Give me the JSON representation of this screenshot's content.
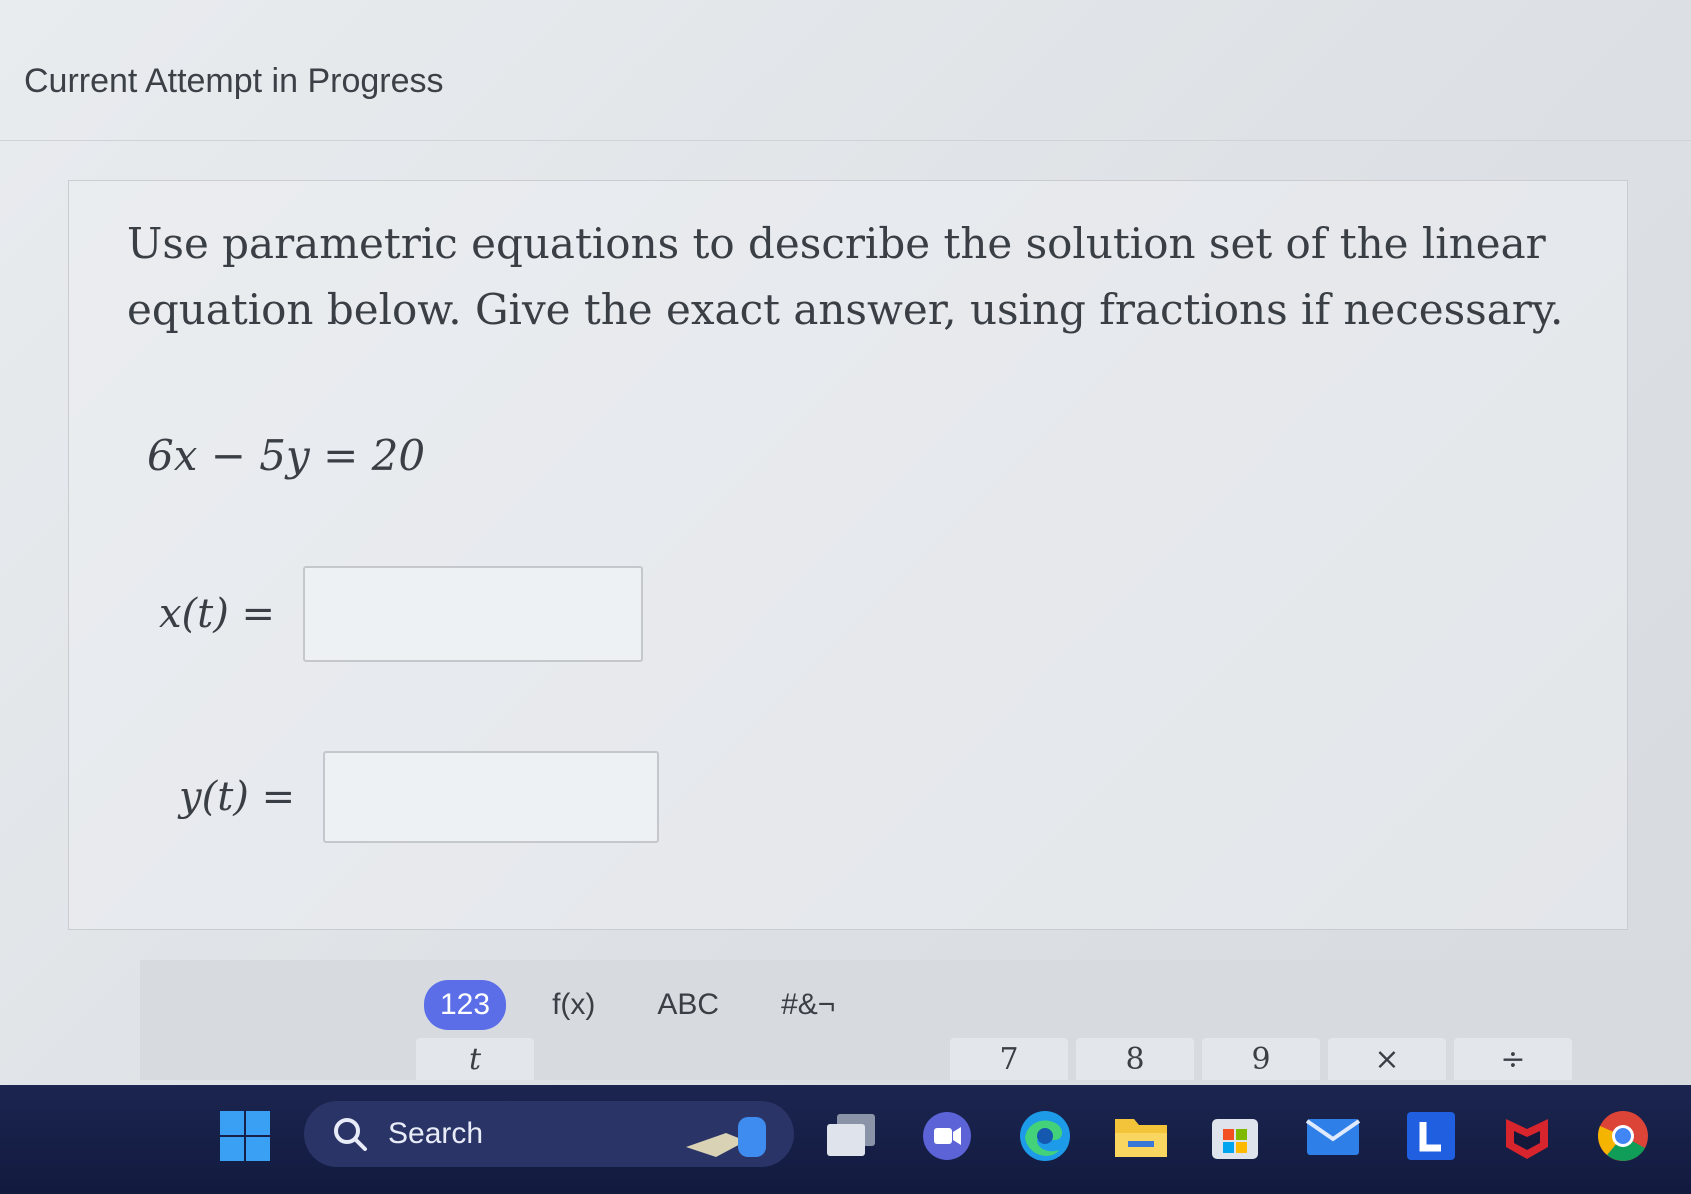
{
  "header": {
    "title": "Current Attempt in Progress"
  },
  "question": {
    "prompt": "Use parametric equations to describe the solution set of the linear equation below. Give the exact answer, using fractions if necessary.",
    "equation": "6x − 5y = 20",
    "answers": [
      {
        "label": "x(t) =",
        "value": ""
      },
      {
        "label": "y(t) =",
        "value": ""
      }
    ]
  },
  "math_toolbar": {
    "tabs": [
      "123",
      "f(x)",
      "ABC",
      "#&¬"
    ],
    "active_tab": "123",
    "keys": [
      "t",
      "7",
      "8",
      "9",
      "×",
      "÷"
    ]
  },
  "taskbar": {
    "search_label": "Search",
    "icons": [
      "windows-start-icon",
      "search-icon",
      "task-view-icon",
      "teams-chat-icon",
      "edge-browser-icon",
      "file-explorer-icon",
      "microsoft-store-icon",
      "mail-icon",
      "l-app-icon",
      "mcafee-icon",
      "chrome-icon"
    ],
    "accent_color": "#5b6ee8"
  }
}
